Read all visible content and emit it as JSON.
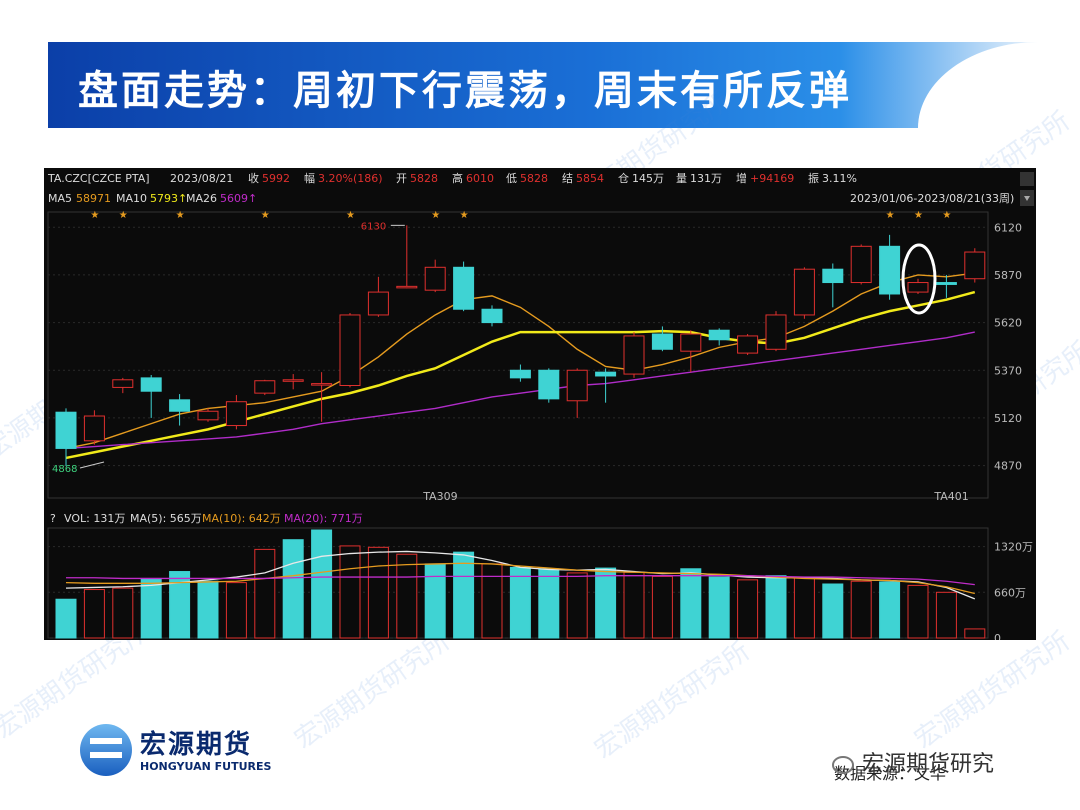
{
  "slide": {
    "title": "盘面走势：周初下行震荡，周末有所反弹",
    "watermark": "宏源期货研究所",
    "logo_cn": "宏源期货",
    "logo_en": "HONGYUAN FUTURES",
    "source": "数据来源：文华",
    "wechat_label": "宏源期货研究"
  },
  "header": {
    "symbol": "TA.CZC[CZCE PTA]",
    "date": "2023/08/21",
    "close_label": "收",
    "close": "5992",
    "change_label": "幅",
    "change": "3.20%(186)",
    "open_label": "开",
    "open": "5828",
    "high_label": "高",
    "high": "6010",
    "low_label": "低",
    "low": "5828",
    "settle_label": "结",
    "settle": "5854",
    "oi_label": "仓",
    "oi": "145万",
    "vol_label": "量",
    "vol": "131万",
    "oi_chg_label": "增",
    "oi_chg": "+94169",
    "amp_label": "振",
    "amp": "3.11%",
    "ma5_label": "MA5",
    "ma5": "58971",
    "ma10_label": "MA10",
    "ma10": "5793↑",
    "ma26_label": "MA26",
    "ma26": "5609↑",
    "range": "2023/01/06-2023/08/21(33周)"
  },
  "volume_header": {
    "q": "?",
    "vol": "VOL: 131万",
    "ma5": "MA(5): 565万",
    "ma10": "MA(10): 642万",
    "ma20": "MA(20): 771万"
  },
  "colors": {
    "up": "#e0302e",
    "down": "#3fd3d3",
    "ma5": "#e8e8e8",
    "ma10": "#e59b1f",
    "ma26": "#f1ea1a",
    "ma20vol": "#c02cc9",
    "purple": "#b02cc9"
  },
  "chart_data": [
    {
      "type": "candlestick",
      "ylim": [
        4700,
        6200
      ],
      "y_ticks": [
        6120,
        5870,
        5620,
        5370,
        5120,
        4870
      ],
      "x_labels": [
        {
          "index": 13,
          "label": "TA309"
        },
        {
          "index": 31,
          "label": "TA401"
        }
      ],
      "annotations": [
        {
          "index": 12,
          "value": 6130,
          "label": "6130"
        },
        {
          "index": 0,
          "value": 4868,
          "label": "4868"
        }
      ],
      "star_indices": [
        1,
        2,
        4,
        7,
        10,
        13,
        14,
        29,
        30,
        31
      ],
      "candles": [
        {
          "o": 5150,
          "c": 4960,
          "h": 5170,
          "l": 4868
        },
        {
          "o": 5000,
          "c": 5130,
          "h": 5160,
          "l": 4980
        },
        {
          "o": 5280,
          "c": 5320,
          "h": 5330,
          "l": 5250
        },
        {
          "o": 5330,
          "c": 5260,
          "h": 5345,
          "l": 5120
        },
        {
          "o": 5215,
          "c": 5155,
          "h": 5245,
          "l": 5080
        },
        {
          "o": 5110,
          "c": 5155,
          "h": 5170,
          "l": 5100
        },
        {
          "o": 5080,
          "c": 5205,
          "h": 5240,
          "l": 5060
        },
        {
          "o": 5250,
          "c": 5315,
          "h": 5320,
          "l": 5240
        },
        {
          "o": 5320,
          "c": 5320,
          "h": 5350,
          "l": 5270
        },
        {
          "o": 5300,
          "c": 5300,
          "h": 5360,
          "l": 5100
        },
        {
          "o": 5290,
          "c": 5660,
          "h": 5670,
          "l": 5280
        },
        {
          "o": 5660,
          "c": 5780,
          "h": 5860,
          "l": 5650
        },
        {
          "o": 5810,
          "c": 5810,
          "h": 6130,
          "l": 5800
        },
        {
          "o": 5790,
          "c": 5910,
          "h": 5950,
          "l": 5780
        },
        {
          "o": 5910,
          "c": 5690,
          "h": 5940,
          "l": 5680
        },
        {
          "o": 5690,
          "c": 5620,
          "h": 5710,
          "l": 5600
        },
        {
          "o": 5370,
          "c": 5330,
          "h": 5400,
          "l": 5310
        },
        {
          "o": 5370,
          "c": 5220,
          "h": 5380,
          "l": 5200
        },
        {
          "o": 5210,
          "c": 5370,
          "h": 5380,
          "l": 5120
        },
        {
          "o": 5360,
          "c": 5340,
          "h": 5380,
          "l": 5200
        },
        {
          "o": 5350,
          "c": 5550,
          "h": 5570,
          "l": 5330
        },
        {
          "o": 5560,
          "c": 5480,
          "h": 5600,
          "l": 5470
        },
        {
          "o": 5470,
          "c": 5560,
          "h": 5580,
          "l": 5360
        },
        {
          "o": 5580,
          "c": 5530,
          "h": 5590,
          "l": 5500
        },
        {
          "o": 5460,
          "c": 5550,
          "h": 5560,
          "l": 5450
        },
        {
          "o": 5480,
          "c": 5660,
          "h": 5680,
          "l": 5470
        },
        {
          "o": 5660,
          "c": 5900,
          "h": 5910,
          "l": 5640
        },
        {
          "o": 5900,
          "c": 5830,
          "h": 5930,
          "l": 5700
        },
        {
          "o": 5830,
          "c": 6020,
          "h": 6030,
          "l": 5820
        },
        {
          "o": 6020,
          "c": 5770,
          "h": 6080,
          "l": 5740
        },
        {
          "o": 5780,
          "c": 5830,
          "h": 5850,
          "l": 5770
        },
        {
          "o": 5830,
          "c": 5820,
          "h": 5870,
          "l": 5750
        },
        {
          "o": 5850,
          "c": 5990,
          "h": 6010,
          "l": 5830
        }
      ],
      "series": [
        {
          "name": "MA5",
          "color_key": "ma10",
          "values": [
            4960,
            4990,
            5040,
            5090,
            5140,
            5170,
            5185,
            5200,
            5230,
            5260,
            5340,
            5440,
            5560,
            5660,
            5740,
            5760,
            5700,
            5600,
            5480,
            5390,
            5370,
            5400,
            5440,
            5490,
            5520,
            5540,
            5600,
            5680,
            5770,
            5830,
            5870,
            5860,
            5880
          ]
        },
        {
          "name": "MA10",
          "color_key": "ma26",
          "values": [
            4910,
            4940,
            4970,
            5000,
            5030,
            5060,
            5100,
            5140,
            5180,
            5220,
            5250,
            5290,
            5340,
            5380,
            5450,
            5520,
            5570,
            5570,
            5570,
            5570,
            5570,
            5575,
            5570,
            5540,
            5520,
            5510,
            5540,
            5590,
            5640,
            5680,
            5710,
            5740,
            5780
          ]
        },
        {
          "name": "MA26",
          "color_key": "purple",
          "values": [
            4960,
            4970,
            4980,
            4990,
            5000,
            5010,
            5020,
            5040,
            5060,
            5090,
            5110,
            5130,
            5150,
            5170,
            5200,
            5230,
            5250,
            5270,
            5290,
            5300,
            5320,
            5340,
            5360,
            5380,
            5400,
            5420,
            5440,
            5460,
            5480,
            5500,
            5520,
            5540,
            5570
          ]
        }
      ]
    },
    {
      "type": "bar",
      "ylim": [
        0,
        1560
      ],
      "unit": "万",
      "y_ticks": [
        {
          "value": 1320,
          "label": "1320万"
        },
        {
          "value": 660,
          "label": "660万"
        },
        {
          "value": 0,
          "label": "0"
        }
      ],
      "values": [
        560,
        700,
        720,
        860,
        960,
        820,
        800,
        1280,
        1420,
        1560,
        1330,
        1310,
        1210,
        1070,
        1240,
        1070,
        1020,
        1000,
        940,
        1010,
        950,
        890,
        1000,
        880,
        840,
        900,
        870,
        780,
        820,
        810,
        760,
        660,
        131
      ],
      "directions": [
        "down",
        "up",
        "up",
        "down",
        "down",
        "down",
        "up",
        "up",
        "down",
        "down",
        "up",
        "up",
        "up",
        "down",
        "down",
        "up",
        "down",
        "down",
        "up",
        "down",
        "up",
        "up",
        "down",
        "down",
        "up",
        "down",
        "up",
        "down",
        "up",
        "down",
        "up",
        "up",
        "up"
      ],
      "series": [
        {
          "name": "MA(5)",
          "color_key": "ma5",
          "values": [
            720,
            730,
            740,
            760,
            800,
            840,
            880,
            940,
            1080,
            1180,
            1220,
            1240,
            1250,
            1230,
            1200,
            1120,
            1020,
            990,
            980,
            990,
            960,
            930,
            940,
            910,
            880,
            870,
            870,
            860,
            840,
            830,
            810,
            730,
            565
          ]
        },
        {
          "name": "MA(10)",
          "color_key": "ma10",
          "values": [
            800,
            790,
            790,
            790,
            800,
            810,
            820,
            860,
            900,
            950,
            1000,
            1040,
            1060,
            1070,
            1080,
            1070,
            1040,
            1010,
            980,
            960,
            950,
            940,
            930,
            920,
            900,
            880,
            860,
            850,
            840,
            830,
            800,
            740,
            642
          ]
        },
        {
          "name": "MA(20)",
          "color_key": "ma20vol",
          "values": [
            870,
            870,
            860,
            860,
            860,
            860,
            860,
            860,
            870,
            880,
            880,
            880,
            880,
            890,
            890,
            890,
            890,
            890,
            890,
            900,
            900,
            900,
            900,
            900,
            900,
            890,
            880,
            880,
            870,
            860,
            850,
            820,
            771
          ]
        }
      ]
    }
  ]
}
